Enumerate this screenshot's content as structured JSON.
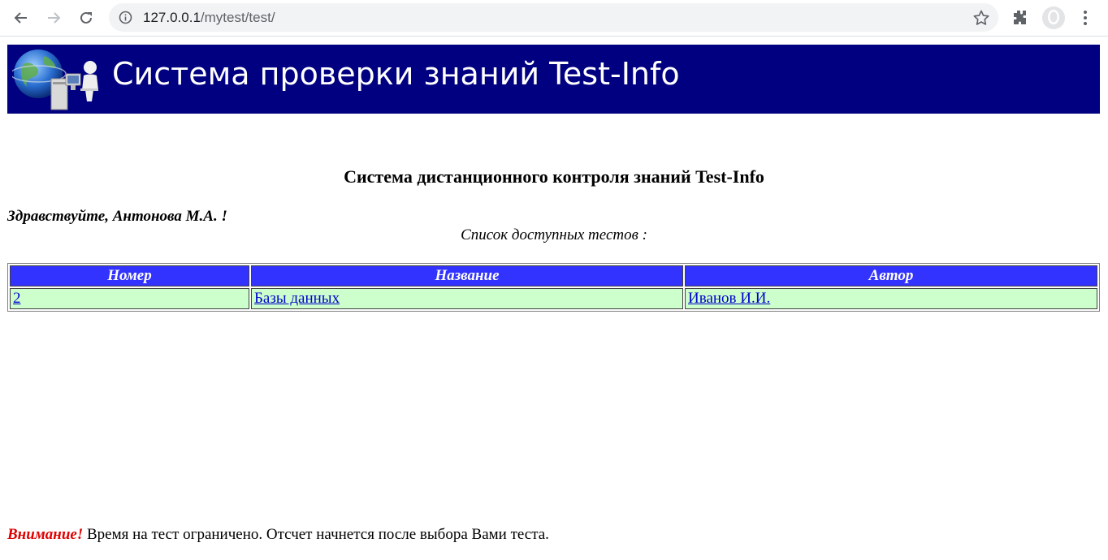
{
  "browser": {
    "url_host": "127.0.0.1",
    "url_path": "/mytest/test/"
  },
  "banner": {
    "title": "Система проверки знаний Test-Info"
  },
  "page": {
    "heading": "Система дистанционного контроля знаний Test-Info",
    "greeting": "Здравствуйте, Антонова М.А. !",
    "list_caption": "Список доступных тестов :"
  },
  "table": {
    "headers": [
      "Номер",
      "Название",
      "Автор"
    ],
    "rows": [
      {
        "number": "2",
        "title": "Базы данных",
        "author": "Иванов И.И."
      }
    ]
  },
  "notice": {
    "warning": "Внимание!",
    "text": " Время на тест ограничено. Отсчет начнется после выбора Вами теста."
  },
  "colors": {
    "banner_bg": "#000080",
    "header_bg": "#3333ff",
    "row_bg": "#ccffcc",
    "warning": "#e00000"
  }
}
